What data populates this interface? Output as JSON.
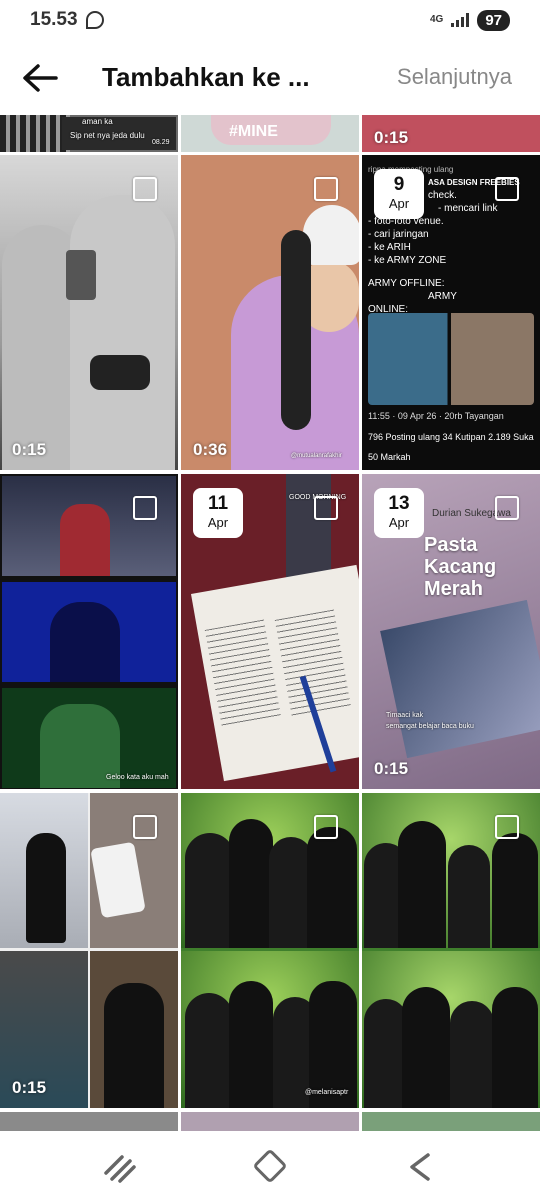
{
  "status": {
    "time": "15.53",
    "network": "4G",
    "battery": "97"
  },
  "header": {
    "title": "Tambahkan ke ...",
    "next_label": "Selanjutnya"
  },
  "top_strip": {
    "chat_label": "aman ka",
    "chat_message": "Sip net nya jeda dulu",
    "chat_time": "08.29",
    "sticker_text": "#MINE",
    "duration": "0:15"
  },
  "tiles": [
    {
      "duration": "0:15"
    },
    {
      "duration": "0:36",
      "watermark": "@mutualanrafakhir"
    },
    {
      "date_day": "9",
      "date_month": "Apr",
      "tweet_header": "rippa memposting ulang",
      "tweet_title": "ASA DESIGN FREEBIES",
      "tweet_lines": [
        "check.",
        "- mencari link",
        "- foto-foto venue.",
        "- cari jaringan",
        "- ke ARIH",
        "- ke ARMY ZONE"
      ],
      "tweet_army_offline": "ARMY OFFLINE:",
      "tweet_army_label": "ARMY",
      "tweet_army_online": "ONLINE:",
      "tweet_meta": "11:55 · 09 Apr 26 · 20rb Tayangan",
      "tweet_stats": "796 Posting ulang   34 Kutipan   2.189 Suka",
      "tweet_bookmarks": "50 Markah"
    },
    {
      "caption": "Geloo kata aku mah"
    },
    {
      "date_day": "11",
      "date_month": "Apr",
      "bottle_text": "GOOD MORNING"
    },
    {
      "date_day": "13",
      "date_month": "Apr",
      "duration": "0:15",
      "book_author": "Durian Sukegawa",
      "book_title_1": "Pasta",
      "book_title_2": "Kacang",
      "book_title_3": "Merah",
      "caption_1": "Timaaci kak",
      "caption_2": "semangat belajar baca buku"
    },
    {
      "duration": "0:15"
    },
    {
      "watermark": "@melanisaptr"
    },
    {}
  ],
  "colors": {
    "accent": "#111111",
    "muted": "#888888",
    "tweet_bg": "#0c0c0c"
  }
}
